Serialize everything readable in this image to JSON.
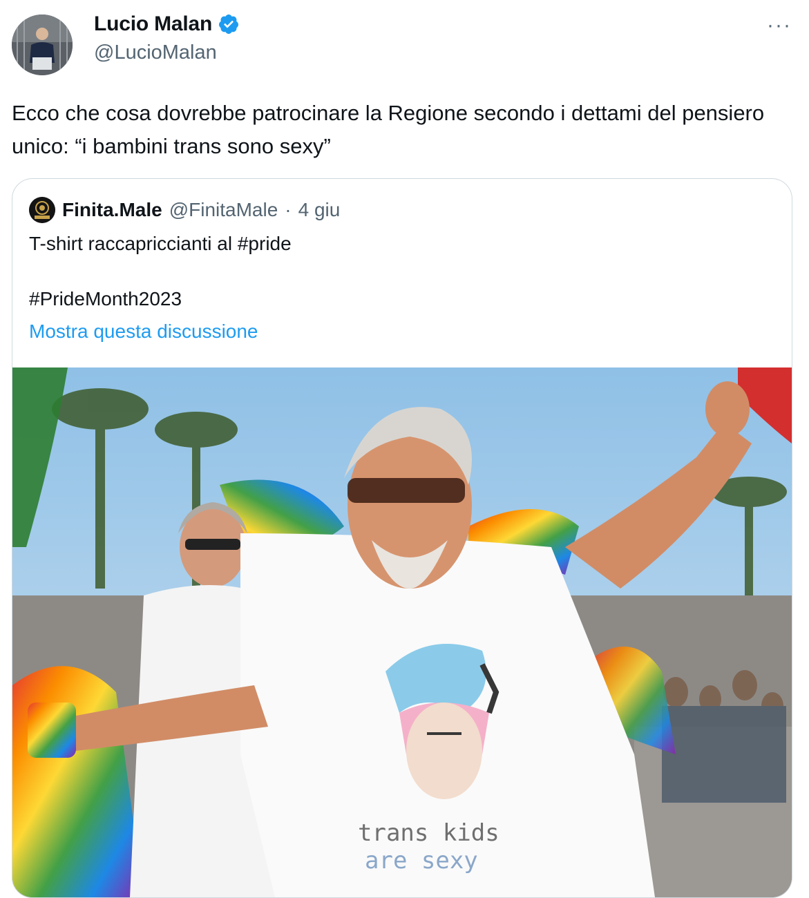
{
  "author": {
    "name": "Lucio Malan",
    "handle": "@LucioMalan",
    "verified_icon": "verified-badge-icon",
    "avatar_icon": "profile-photo"
  },
  "more_label": "···",
  "tweet": {
    "text": "Ecco che cosa dovrebbe patrocinare la Regione secondo i dettami del pensiero unico: “i bambini trans sono sexy”"
  },
  "quoted": {
    "name": "Finita.Male",
    "handle": "@FinitaMale",
    "separator": "·",
    "date": "4 giu",
    "line1": "T-shirt raccapriccianti al #pride",
    "line2": "#PrideMonth2023",
    "show_thread": "Mostra questa discussione",
    "image_shirt_text": [
      "trans kids",
      "are sexy"
    ]
  },
  "colors": {
    "link": "#1d9bf0",
    "secondary_text": "#536471",
    "border": "#cfd9de",
    "verified": "#1d9bf0"
  }
}
